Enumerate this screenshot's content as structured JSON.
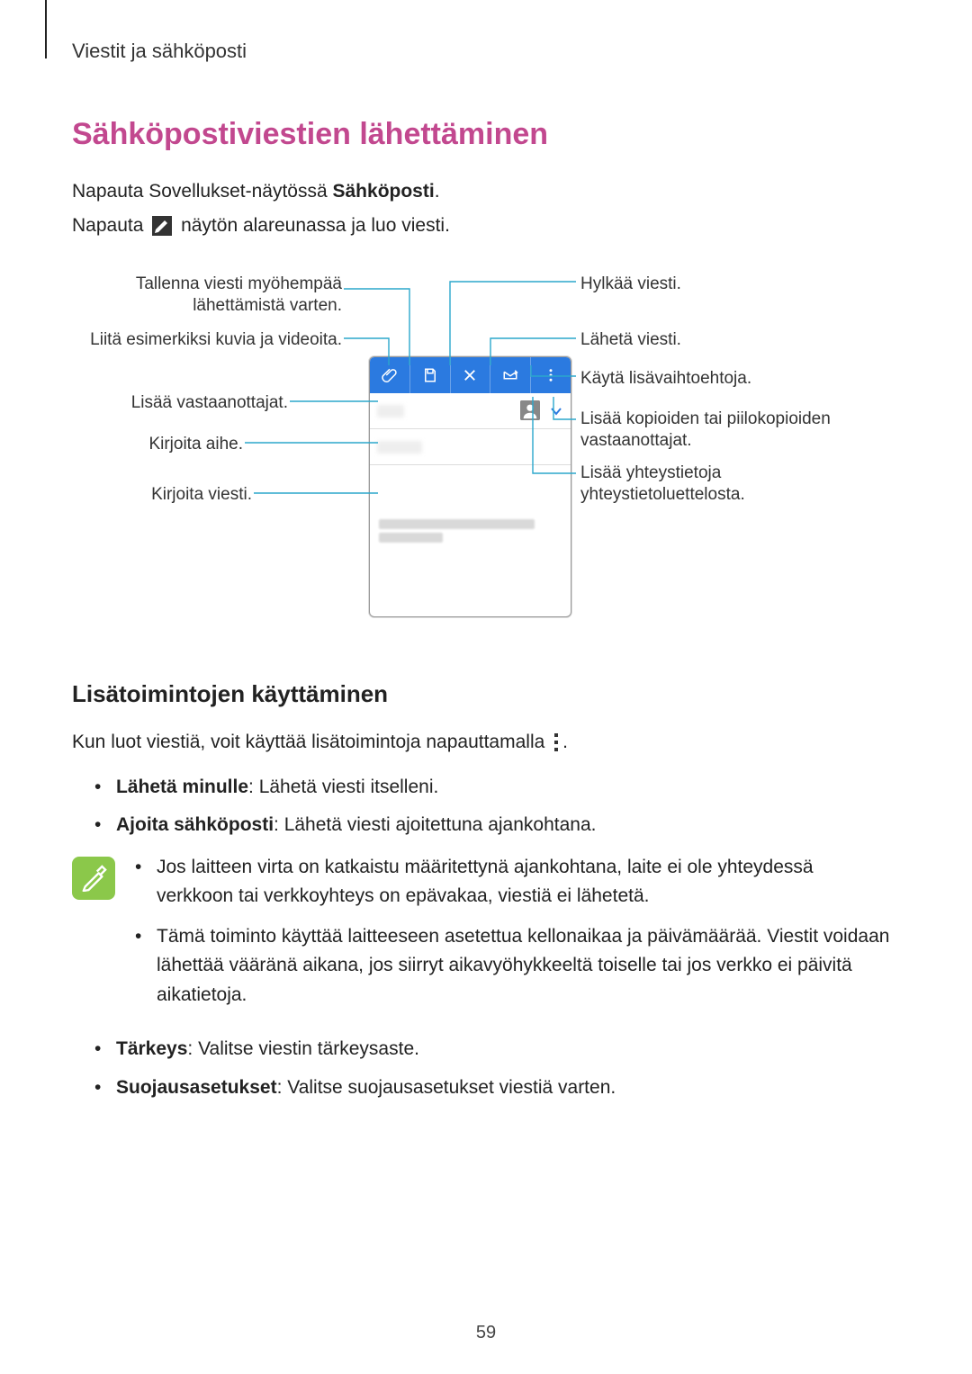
{
  "header": "Viestit ja sähköposti",
  "title": "Sähköpostiviestien lähettäminen",
  "intro1_pre": "Napauta Sovellukset-näytössä ",
  "intro1_bold": "Sähköposti",
  "intro1_post": ".",
  "intro2_pre": "Napauta ",
  "intro2_post": " näytön alareunassa ja luo viesti.",
  "callouts": {
    "left1": "Tallenna viesti myöhempää\nlähettämistä varten.",
    "left2": "Liitä esimerkiksi kuvia ja videoita.",
    "left3": "Lisää vastaanottajat.",
    "left4": "Kirjoita aihe.",
    "left5": "Kirjoita viesti.",
    "right1": "Hylkää viesti.",
    "right2": "Lähetä viesti.",
    "right3": "Käytä lisävaihtoehtoja.",
    "right4": "Lisää kopioiden tai piilokopioiden vastaanottajat.",
    "right5": "Lisää yhteystietoja yhteystietoluettelosta."
  },
  "subtitle": "Lisätoimintojen käyttäminen",
  "sub_para_pre": "Kun luot viestiä, voit käyttää lisätoimintoja napauttamalla ",
  "sub_para_post": ".",
  "bullets": [
    {
      "bold": "Lähetä minulle",
      "text": ": Lähetä viesti itselleni."
    },
    {
      "bold": "Ajoita sähköposti",
      "text": ": Lähetä viesti ajoitettuna ajankohtana."
    }
  ],
  "note_items": [
    "Jos laitteen virta on katkaistu määritettynä ajankohtana, laite ei ole yhteydessä verkkoon tai verkkoyhteys on epävakaa, viestiä ei lähetetä.",
    "Tämä toiminto käyttää laitteeseen asetettua kellonaikaa ja päivämäärää. Viestit voidaan lähettää vääränä aikana, jos siirryt aikavyöhykkeeltä toiselle tai jos verkko ei päivitä aikatietoja."
  ],
  "bullets2": [
    {
      "bold": "Tärkeys",
      "text": ": Valitse viestin tärkeysaste."
    },
    {
      "bold": "Suojausasetukset",
      "text": ": Valitse suojausasetukset viestiä varten."
    }
  ],
  "page_number": "59"
}
